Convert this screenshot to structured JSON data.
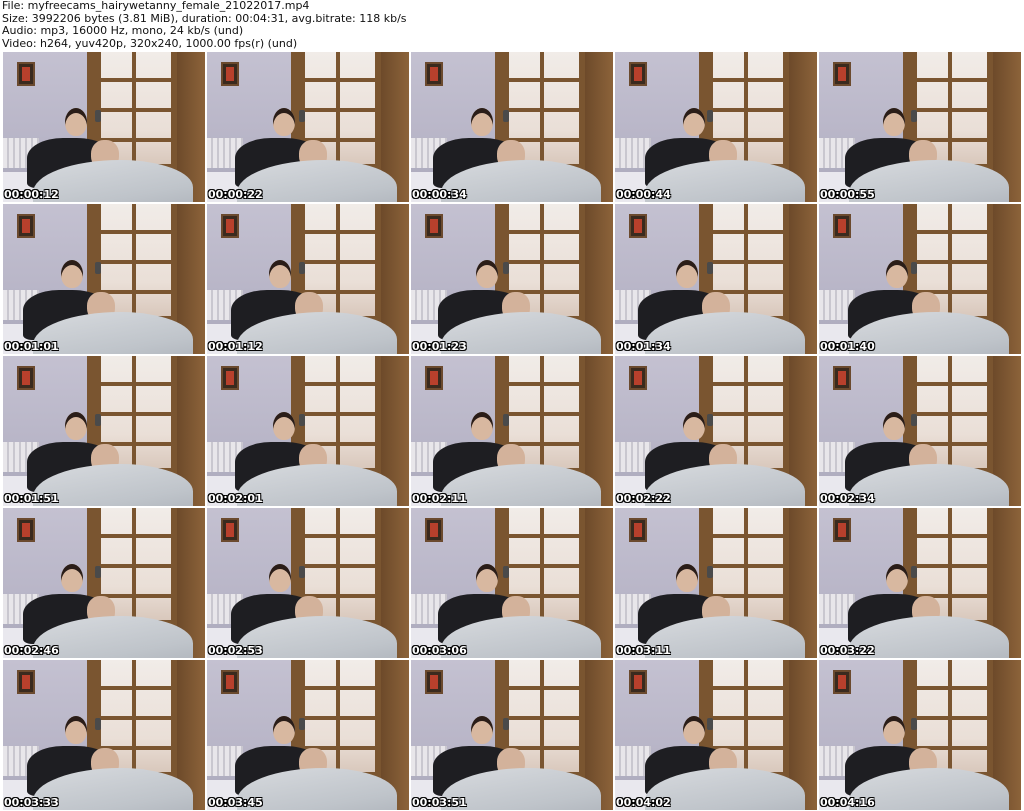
{
  "header": {
    "file": "File: myfreecams_hairywetanny_female_21022017.mp4",
    "size": "Size: 3992206 bytes (3.81 MiB), duration: 00:04:31, avg.bitrate: 118 kb/s",
    "audio": "Audio: mp3, 16000 Hz, mono, 24 kb/s (und)",
    "video": "Video: h264, yuv420p, 320x240, 1000.00 fps(r) (und)"
  },
  "thumbnails": [
    {
      "timestamp": "00:00:12"
    },
    {
      "timestamp": "00:00:22"
    },
    {
      "timestamp": "00:00:34"
    },
    {
      "timestamp": "00:00:44"
    },
    {
      "timestamp": "00:00:55"
    },
    {
      "timestamp": "00:01:01"
    },
    {
      "timestamp": "00:01:12"
    },
    {
      "timestamp": "00:01:23"
    },
    {
      "timestamp": "00:01:34"
    },
    {
      "timestamp": "00:01:40"
    },
    {
      "timestamp": "00:01:51"
    },
    {
      "timestamp": "00:02:01"
    },
    {
      "timestamp": "00:02:11"
    },
    {
      "timestamp": "00:02:22"
    },
    {
      "timestamp": "00:02:34"
    },
    {
      "timestamp": "00:02:46"
    },
    {
      "timestamp": "00:02:53"
    },
    {
      "timestamp": "00:03:06"
    },
    {
      "timestamp": "00:03:11"
    },
    {
      "timestamp": "00:03:22"
    },
    {
      "timestamp": "00:03:33"
    },
    {
      "timestamp": "00:03:45"
    },
    {
      "timestamp": "00:03:51"
    },
    {
      "timestamp": "00:04:02"
    },
    {
      "timestamp": "00:04:16"
    }
  ]
}
